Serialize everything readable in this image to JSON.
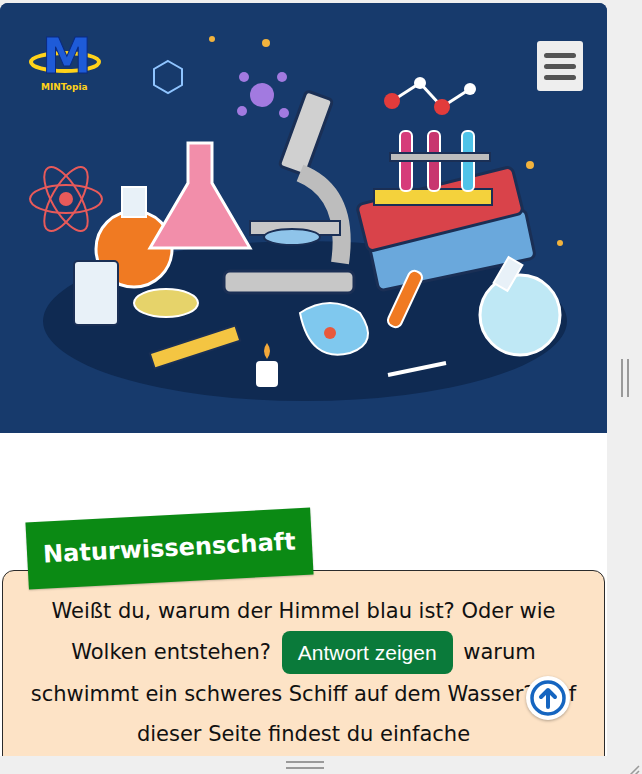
{
  "logo": {
    "mark": "M",
    "name": "MINTopia"
  },
  "section": {
    "title": "Naturwissenschaft"
  },
  "intro": {
    "before": "Weißt du, warum der Himmel blau ist? Oder wie Wolken entstehen?",
    "button": "Antwort zeigen",
    "after": "warum schwimmt ein schweres Schiff auf dem Wasser? Auf dieser Seite findest du einfache"
  }
}
